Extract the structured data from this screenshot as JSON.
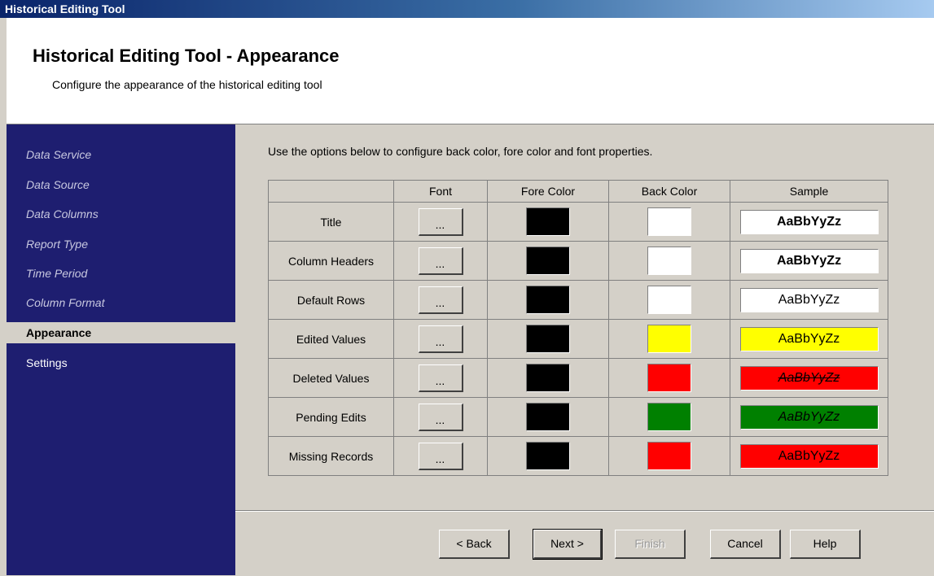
{
  "window": {
    "title": "Historical Editing Tool"
  },
  "header": {
    "title": "Historical Editing Tool - Appearance",
    "subtitle": "Configure the appearance of the historical editing tool"
  },
  "sidebar": {
    "items": [
      {
        "label": "Data Service",
        "state": "completed"
      },
      {
        "label": "Data Source",
        "state": "completed"
      },
      {
        "label": "Data Columns",
        "state": "completed"
      },
      {
        "label": "Report Type",
        "state": "completed"
      },
      {
        "label": "Time Period",
        "state": "completed"
      },
      {
        "label": "Column Format",
        "state": "completed"
      },
      {
        "label": "Appearance",
        "state": "active"
      },
      {
        "label": "Settings",
        "state": "pending"
      }
    ]
  },
  "main": {
    "instructions": "Use the options below to configure back color, fore color and font properties.",
    "columns": [
      "",
      "Font",
      "Fore Color",
      "Back Color",
      "Sample"
    ],
    "font_button_label": "...",
    "sample_text": "AaBbYyZz",
    "rows": [
      {
        "label": "Title",
        "fore_color": "#000000",
        "back_color": "#ffffff",
        "sample_fore": "#000000",
        "sample_back": "#ffffff",
        "sample_style": "bold"
      },
      {
        "label": "Column Headers",
        "fore_color": "#000000",
        "back_color": "#ffffff",
        "sample_fore": "#000000",
        "sample_back": "#ffffff",
        "sample_style": "bold"
      },
      {
        "label": "Default Rows",
        "fore_color": "#000000",
        "back_color": "#ffffff",
        "sample_fore": "#000000",
        "sample_back": "#ffffff",
        "sample_style": "normal"
      },
      {
        "label": "Edited Values",
        "fore_color": "#000000",
        "back_color": "#ffff00",
        "sample_fore": "#000000",
        "sample_back": "#ffff00",
        "sample_style": "normal"
      },
      {
        "label": "Deleted Values",
        "fore_color": "#000000",
        "back_color": "#ff0000",
        "sample_fore": "#000000",
        "sample_back": "#ff0000",
        "sample_style": "italic strikethrough"
      },
      {
        "label": "Pending Edits",
        "fore_color": "#000000",
        "back_color": "#008000",
        "sample_fore": "#000000",
        "sample_back": "#008000",
        "sample_style": "italic"
      },
      {
        "label": "Missing Records",
        "fore_color": "#000000",
        "back_color": "#ff0000",
        "sample_fore": "#000000",
        "sample_back": "#ff0000",
        "sample_style": "normal"
      }
    ]
  },
  "footer": {
    "back_label": "< Back",
    "next_label": "Next >",
    "finish_label": "Finish",
    "cancel_label": "Cancel",
    "help_label": "Help"
  }
}
